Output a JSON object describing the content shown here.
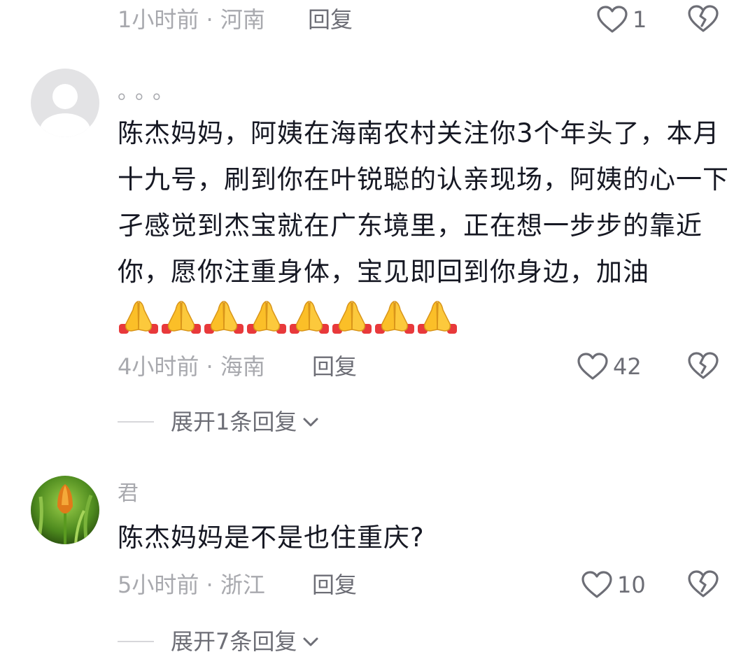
{
  "comments": [
    {
      "time_location": "1小时前 · 河南",
      "reply_label": "回复",
      "likes": "1"
    },
    {
      "username": "。。。",
      "text": "陈杰妈妈，阿姨在海南农村关注你3个年头了，本月十九号，刷到你在叶锐聪的认亲现场，阿姨的心一下孑感觉到杰宝就在广东境里，正在想一步步的靠近你，愿你注重身体，宝见即回到你身边，加油",
      "emoji_count": 8,
      "emoji_name": "folded-hands",
      "time_location": "4小时前 · 海南",
      "reply_label": "回复",
      "likes": "42",
      "expand_label": "展开1条回复"
    },
    {
      "username": "君",
      "text": "陈杰妈妈是不是也住重庆?",
      "time_location": "5小时前 · 浙江",
      "reply_label": "回复",
      "likes": "10",
      "expand_label": "展开7条回复"
    }
  ],
  "icons": {
    "like": "heart-outline-icon",
    "dislike": "broken-heart-icon",
    "expand": "chevron-down-icon"
  },
  "colors": {
    "text": "#161823",
    "secondary": "#a8a9ae",
    "action": "#6d6e76"
  }
}
